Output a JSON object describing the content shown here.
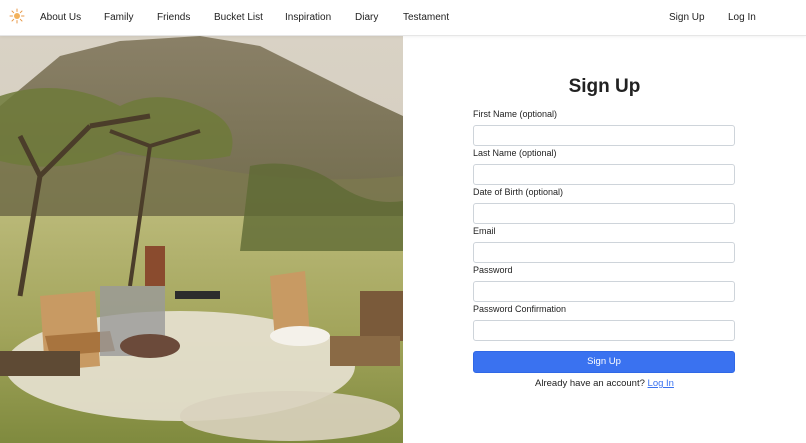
{
  "brand": {
    "logo_icon": "sun-icon",
    "accent": "#e89a4a"
  },
  "nav": {
    "left": [
      "About Us",
      "Family",
      "Friends",
      "Bucket List",
      "Inspiration",
      "Diary",
      "Testament"
    ],
    "signup": "Sign Up",
    "login": "Log In"
  },
  "hero": {
    "image": "picnic-in-meadow-photo"
  },
  "form": {
    "title": "Sign Up",
    "fields": [
      {
        "label": "First Name (optional)",
        "value": "",
        "type": "text"
      },
      {
        "label": "Last Name (optional)",
        "value": "",
        "type": "text"
      },
      {
        "label": "Date of Birth (optional)",
        "value": "",
        "type": "text"
      },
      {
        "label": "Email",
        "value": "",
        "type": "email"
      },
      {
        "label": "Password",
        "value": "",
        "type": "password"
      },
      {
        "label": "Password Confirmation",
        "value": "",
        "type": "password"
      }
    ],
    "submit": "Sign Up",
    "have_account": "Already have an account?",
    "login_link": "Log In"
  },
  "colors": {
    "primary": "#3a72f0",
    "border": "#ced4da"
  }
}
